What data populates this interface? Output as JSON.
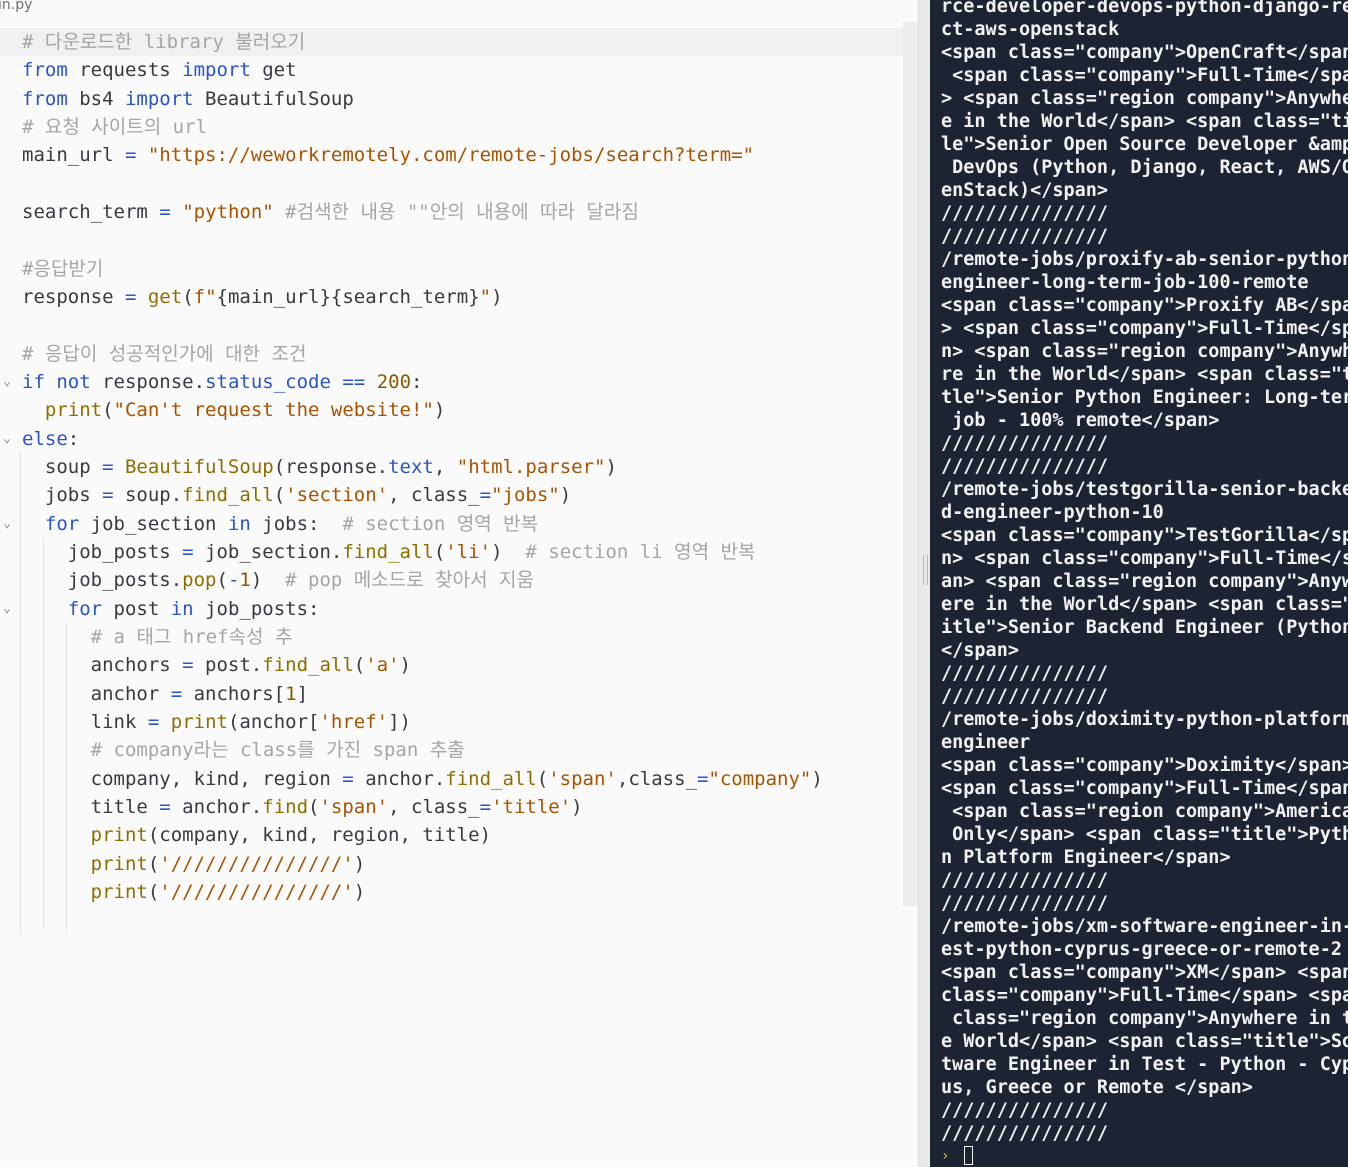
{
  "editor": {
    "tab_label": "in.py",
    "lines": [
      [
        [
          "com",
          "# 다운로드한 library 불러오기"
        ]
      ],
      [
        [
          "kw",
          "from"
        ],
        [
          "p",
          " requests "
        ],
        [
          "kw",
          "import"
        ],
        [
          "p",
          " get"
        ]
      ],
      [
        [
          "kw",
          "from"
        ],
        [
          "p",
          " bs4 "
        ],
        [
          "kw",
          "import"
        ],
        [
          "p",
          " BeautifulSoup"
        ]
      ],
      [
        [
          "com",
          "# 요청 사이트의 url"
        ]
      ],
      [
        [
          "p",
          "main_url "
        ],
        [
          "kw",
          "="
        ],
        [
          "p",
          " "
        ],
        [
          "str",
          "\"https://weworkremotely.com/remote-jobs/search?term=\""
        ]
      ],
      [],
      [
        [
          "p",
          "search_term "
        ],
        [
          "kw",
          "="
        ],
        [
          "p",
          " "
        ],
        [
          "str",
          "\"python\""
        ],
        [
          "p",
          " "
        ],
        [
          "com",
          "#검색한 내용 \"\"안의 내용에 따라 달라짐"
        ]
      ],
      [],
      [
        [
          "com",
          "#응답받기"
        ]
      ],
      [
        [
          "p",
          "response "
        ],
        [
          "kw",
          "="
        ],
        [
          "p",
          " "
        ],
        [
          "fn",
          "get"
        ],
        [
          "p",
          "("
        ],
        [
          "str",
          "f\""
        ],
        [
          "p",
          "{main_url}{search_term}"
        ],
        [
          "str",
          "\""
        ],
        [
          "p",
          ")"
        ]
      ],
      [],
      [
        [
          "com",
          "# 응답이 성공적인가에 대한 조건"
        ]
      ],
      [
        [
          "kw",
          "if"
        ],
        [
          "p",
          " "
        ],
        [
          "kw",
          "not"
        ],
        [
          "p",
          " response."
        ],
        [
          "attr",
          "status_code"
        ],
        [
          "p",
          " "
        ],
        [
          "kw",
          "=="
        ],
        [
          "p",
          " "
        ],
        [
          "num",
          "200"
        ],
        [
          "p",
          ":"
        ]
      ],
      [
        [
          "p",
          "  "
        ],
        [
          "fn",
          "print"
        ],
        [
          "p",
          "("
        ],
        [
          "str",
          "\"Can't request the website!\""
        ],
        [
          "p",
          ")"
        ]
      ],
      [
        [
          "kw",
          "else"
        ],
        [
          "p",
          ":"
        ]
      ],
      [
        [
          "p",
          "  soup "
        ],
        [
          "kw",
          "="
        ],
        [
          "p",
          " "
        ],
        [
          "fn",
          "BeautifulSoup"
        ],
        [
          "p",
          "(response."
        ],
        [
          "attr",
          "text"
        ],
        [
          "p",
          ", "
        ],
        [
          "str",
          "\"html.parser\""
        ],
        [
          "p",
          ")"
        ]
      ],
      [
        [
          "p",
          "  jobs "
        ],
        [
          "kw",
          "="
        ],
        [
          "p",
          " soup."
        ],
        [
          "fn",
          "find_all"
        ],
        [
          "p",
          "("
        ],
        [
          "str",
          "'section'"
        ],
        [
          "p",
          ", class_"
        ],
        [
          "kw",
          "="
        ],
        [
          "str",
          "\"jobs\""
        ],
        [
          "p",
          ")"
        ]
      ],
      [
        [
          "p",
          "  "
        ],
        [
          "kw",
          "for"
        ],
        [
          "p",
          " job_section "
        ],
        [
          "kw",
          "in"
        ],
        [
          "p",
          " jobs:  "
        ],
        [
          "com",
          "# section 영역 반복"
        ]
      ],
      [
        [
          "p",
          "    job_posts "
        ],
        [
          "kw",
          "="
        ],
        [
          "p",
          " job_section."
        ],
        [
          "fn",
          "find_all"
        ],
        [
          "p",
          "("
        ],
        [
          "str",
          "'li'"
        ],
        [
          "p",
          ")  "
        ],
        [
          "com",
          "# section li 영역 반복"
        ]
      ],
      [
        [
          "p",
          "    job_posts."
        ],
        [
          "fn",
          "pop"
        ],
        [
          "p",
          "("
        ],
        [
          "kw",
          "-"
        ],
        [
          "num",
          "1"
        ],
        [
          "p",
          ")  "
        ],
        [
          "com",
          "# pop 메소드로 찾아서 지움"
        ]
      ],
      [
        [
          "p",
          "    "
        ],
        [
          "kw",
          "for"
        ],
        [
          "p",
          " post "
        ],
        [
          "kw",
          "in"
        ],
        [
          "p",
          " job_posts:"
        ]
      ],
      [
        [
          "p",
          "      "
        ],
        [
          "com",
          "# a 태그 href속성 추"
        ]
      ],
      [
        [
          "p",
          "      anchors "
        ],
        [
          "kw",
          "="
        ],
        [
          "p",
          " post."
        ],
        [
          "fn",
          "find_all"
        ],
        [
          "p",
          "("
        ],
        [
          "str",
          "'a'"
        ],
        [
          "p",
          ")"
        ]
      ],
      [
        [
          "p",
          "      anchor "
        ],
        [
          "kw",
          "="
        ],
        [
          "p",
          " anchors["
        ],
        [
          "num",
          "1"
        ],
        [
          "p",
          "]"
        ]
      ],
      [
        [
          "p",
          "      link "
        ],
        [
          "kw",
          "="
        ],
        [
          "p",
          " "
        ],
        [
          "fn",
          "print"
        ],
        [
          "p",
          "(anchor["
        ],
        [
          "str",
          "'href'"
        ],
        [
          "p",
          "])"
        ]
      ],
      [
        [
          "p",
          "      "
        ],
        [
          "com",
          "# company라는 class를 가진 span 추출"
        ]
      ],
      [
        [
          "p",
          "      company, kind, region "
        ],
        [
          "kw",
          "="
        ],
        [
          "p",
          " anchor."
        ],
        [
          "fn",
          "find_all"
        ],
        [
          "p",
          "("
        ],
        [
          "str",
          "'span'"
        ],
        [
          "p",
          ",class_"
        ],
        [
          "kw",
          "="
        ],
        [
          "str",
          "\"company\""
        ],
        [
          "p",
          ")"
        ]
      ],
      [
        [
          "p",
          "      title "
        ],
        [
          "kw",
          "="
        ],
        [
          "p",
          " anchor."
        ],
        [
          "fn",
          "find"
        ],
        [
          "p",
          "("
        ],
        [
          "str",
          "'span'"
        ],
        [
          "p",
          ", class_"
        ],
        [
          "kw",
          "="
        ],
        [
          "str",
          "'title'"
        ],
        [
          "p",
          ")"
        ]
      ],
      [
        [
          "p",
          "      "
        ],
        [
          "fn",
          "print"
        ],
        [
          "p",
          "(company, kind, region, title)"
        ]
      ],
      [
        [
          "p",
          "      "
        ],
        [
          "fn",
          "print"
        ],
        [
          "p",
          "("
        ],
        [
          "str",
          "'///////////////'"
        ],
        [
          "p",
          ")"
        ]
      ],
      [
        [
          "p",
          "      "
        ],
        [
          "fn",
          "print"
        ],
        [
          "p",
          "("
        ],
        [
          "str",
          "'///////////////'"
        ],
        [
          "p",
          ")"
        ]
      ]
    ]
  },
  "terminal": {
    "lines": [
      "rce-developer-devops-python-django-re",
      "ct-aws-openstack",
      "<span class=\"company\">OpenCraft</span",
      " <span class=\"company\">Full-Time</spa",
      "> <span class=\"region company\">Anywhe",
      "e in the World</span> <span class=\"ti",
      "le\">Senior Open Source Developer &amp",
      " DevOps (Python, Django, React, AWS/O",
      "enStack)</span>",
      "///////////////",
      "///////////////",
      "/remote-jobs/proxify-ab-senior-python",
      "engineer-long-term-job-100-remote",
      "<span class=\"company\">Proxify AB</spa",
      "> <span class=\"company\">Full-Time</sp",
      "n> <span class=\"region company\">Anywh",
      "re in the World</span> <span class=\"t",
      "tle\">Senior Python Engineer: Long-ter",
      " job - 100% remote</span>",
      "///////////////",
      "///////////////",
      "/remote-jobs/testgorilla-senior-backe",
      "d-engineer-python-10",
      "<span class=\"company\">TestGorilla</sp",
      "n> <span class=\"company\">Full-Time</s",
      "an> <span class=\"region company\">Anyw",
      "ere in the World</span> <span class=\"",
      "itle\">Senior Backend Engineer (Python",
      "</span>",
      "///////////////",
      "///////////////",
      "/remote-jobs/doximity-python-platform",
      "engineer",
      "<span class=\"company\">Doximity</span>",
      "<span class=\"company\">Full-Time</span",
      " <span class=\"region company\">America",
      " Only</span> <span class=\"title\">Pyth",
      "n Platform Engineer</span>",
      "///////////////",
      "///////////////",
      "/remote-jobs/xm-software-engineer-in-",
      "est-python-cyprus-greece-or-remote-2",
      "<span class=\"company\">XM</span> <span",
      "class=\"company\">Full-Time</span> <spa",
      " class=\"region company\">Anywhere in t",
      "e World</span> <span class=\"title\">So",
      "tware Engineer in Test - Python - Cyp",
      "us, Greece or Remote </span>",
      "///////////////",
      "///////////////"
    ],
    "prompt_glyph": "›"
  }
}
